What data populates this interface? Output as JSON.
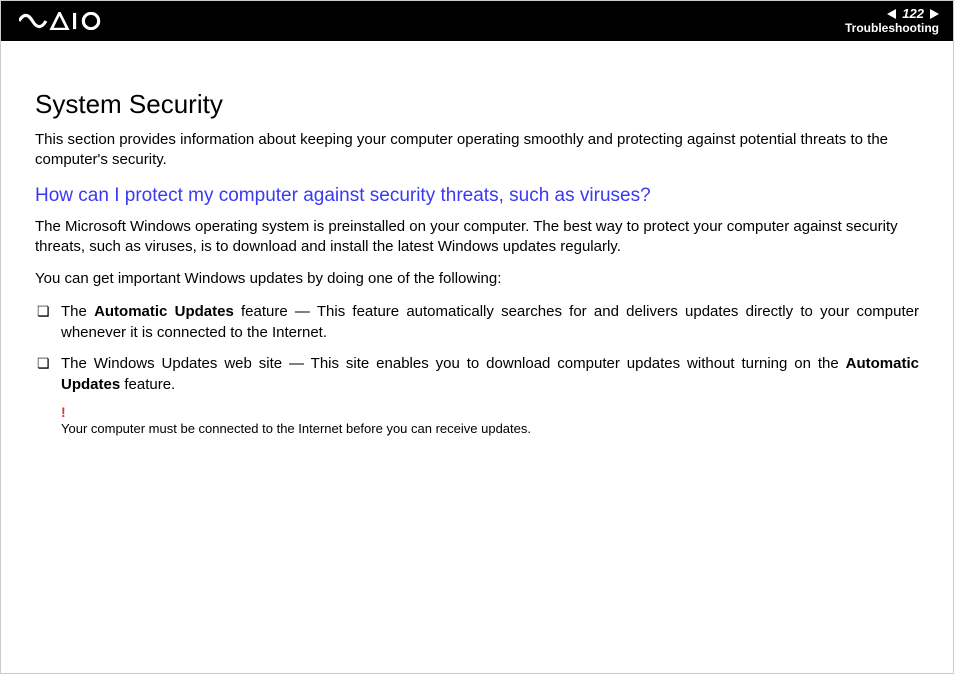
{
  "header": {
    "logo_name": "vaio-logo",
    "page_number": "122",
    "section": "Troubleshooting"
  },
  "title": "System Security",
  "intro": "This section provides information about keeping your computer operating smoothly and protecting against potential threats to the computer's security.",
  "question": "How can I protect my computer against security threats, such as viruses?",
  "answer_p1": "The Microsoft Windows operating system is preinstalled on your computer. The best way to protect your computer against security threats, such as viruses, is to download and install the latest Windows updates regularly.",
  "answer_p2": "You can get important Windows updates by doing one of the following:",
  "bullets": [
    {
      "lead_bold": "Automatic Updates",
      "prefix": "The ",
      "suffix": " feature — This feature automatically searches for and delivers updates directly to your computer whenever it is connected to the Internet."
    },
    {
      "prefix": "The Windows Updates web site — This site enables you to download computer updates without turning on the ",
      "lead_bold": "Automatic Updates",
      "suffix": " feature."
    }
  ],
  "note": {
    "mark": "!",
    "text": "Your computer must be connected to the Internet before you can receive updates."
  }
}
